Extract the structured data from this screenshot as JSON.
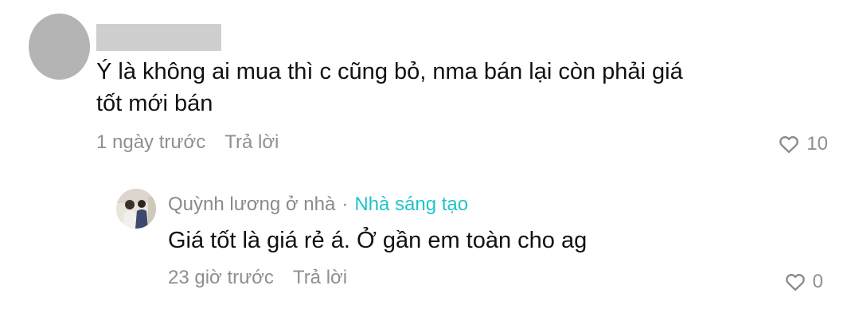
{
  "comment": {
    "text": "Ý là không ai mua thì c cũng bỏ, nma bán lại còn phải giá\ntốt mới bán",
    "timestamp": "1 ngày trước",
    "reply_label": "Trả lời",
    "like_count": "10",
    "like_icon": "heart-outline-icon"
  },
  "reply": {
    "username": "Quỳnh lương ở nhà",
    "separator": "·",
    "badge": "Nhà sáng tạo",
    "badge_color": "#20c3c9",
    "text": "Giá tốt là giá rẻ á. Ở gần em toàn cho ag",
    "timestamp": "23 giờ trước",
    "reply_label": "Trả lời",
    "like_count": "0",
    "like_icon": "heart-outline-icon"
  }
}
